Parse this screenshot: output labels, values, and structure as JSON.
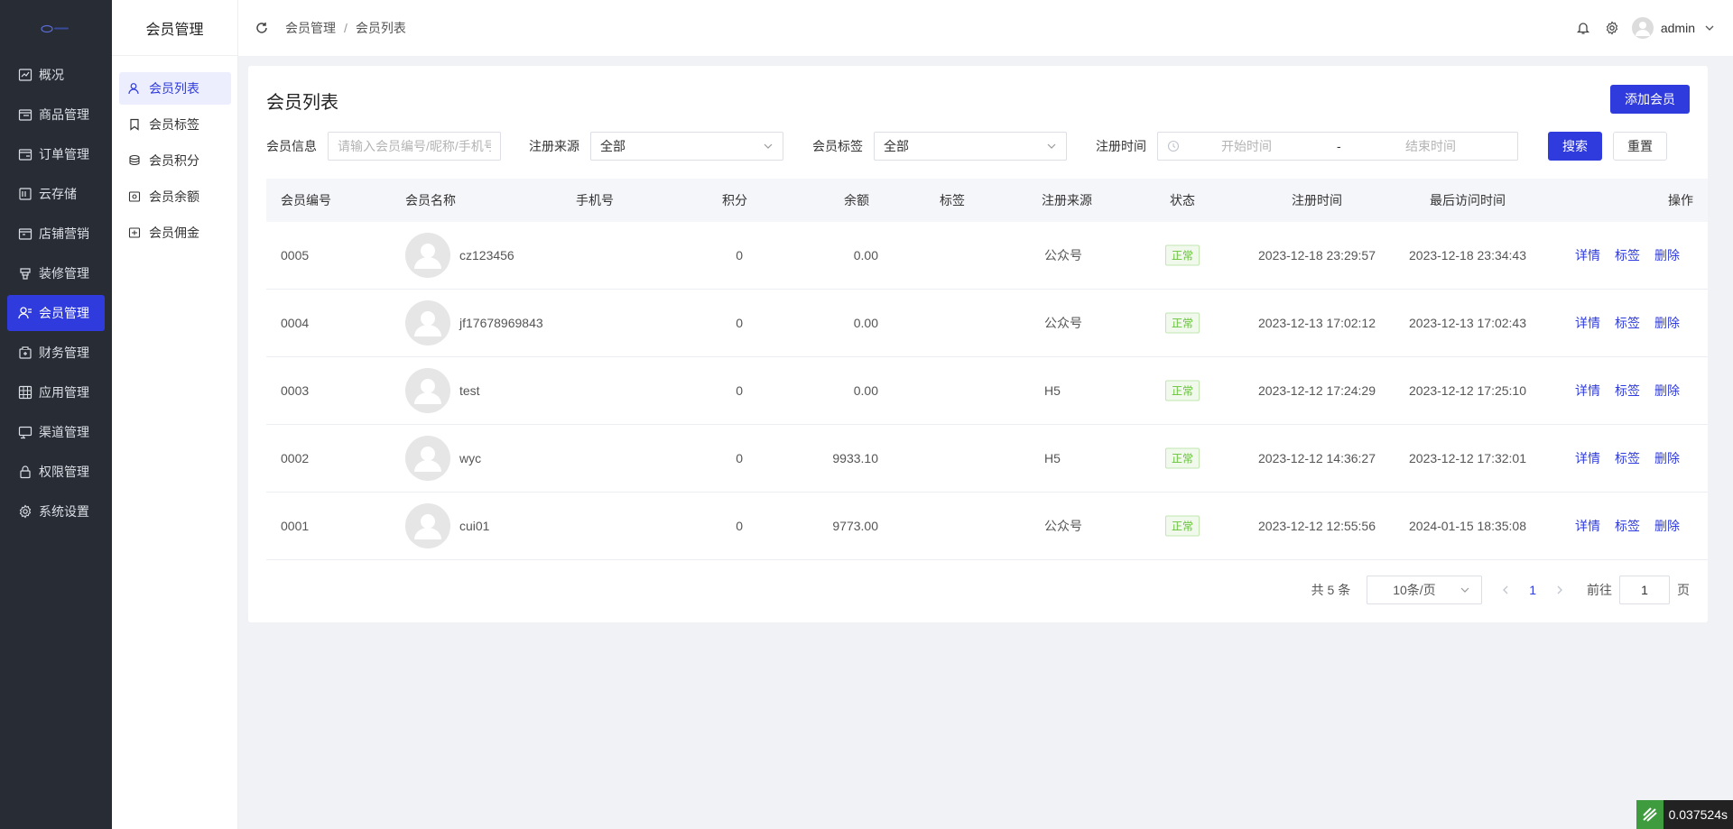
{
  "nav": {
    "items": [
      {
        "label": "概况",
        "icon": "chart-line-icon"
      },
      {
        "label": "商品管理",
        "icon": "goods-icon"
      },
      {
        "label": "订单管理",
        "icon": "order-icon"
      },
      {
        "label": "云存储",
        "icon": "cloud-storage-icon"
      },
      {
        "label": "店铺营销",
        "icon": "shop-marketing-icon"
      },
      {
        "label": "装修管理",
        "icon": "decoration-icon"
      },
      {
        "label": "会员管理",
        "icon": "member-icon"
      },
      {
        "label": "财务管理",
        "icon": "finance-icon"
      },
      {
        "label": "应用管理",
        "icon": "app-grid-icon"
      },
      {
        "label": "渠道管理",
        "icon": "channel-icon"
      },
      {
        "label": "权限管理",
        "icon": "lock-icon"
      },
      {
        "label": "系统设置",
        "icon": "gear-icon"
      }
    ],
    "active_index": 6
  },
  "submenu": {
    "title": "会员管理",
    "items": [
      {
        "label": "会员列表",
        "icon": "user-icon"
      },
      {
        "label": "会员标签",
        "icon": "bookmark-icon"
      },
      {
        "label": "会员积分",
        "icon": "coins-icon"
      },
      {
        "label": "会员余额",
        "icon": "wallet-icon"
      },
      {
        "label": "会员佣金",
        "icon": "commission-icon"
      }
    ],
    "active_index": 0
  },
  "header": {
    "breadcrumb": [
      "会员管理",
      "会员列表"
    ],
    "breadcrumb_sep": "/",
    "username": "admin"
  },
  "main": {
    "title": "会员列表",
    "add_button": "添加会员",
    "filters": {
      "info_label": "会员信息",
      "info_placeholder": "请输入会员编号/昵称/手机号",
      "source_label": "注册来源",
      "source_value": "全部",
      "tag_label": "会员标签",
      "tag_value": "全部",
      "time_label": "注册时间",
      "start_placeholder": "开始时间",
      "range_sep": "-",
      "end_placeholder": "结束时间",
      "search_button": "搜索",
      "reset_button": "重置"
    },
    "table": {
      "columns": [
        "会员编号",
        "会员名称",
        "手机号",
        "积分",
        "余额",
        "标签",
        "注册来源",
        "状态",
        "注册时间",
        "最后访问时间",
        "操作"
      ],
      "rows": [
        {
          "id": "0005",
          "name": "cz123456",
          "phone": "",
          "points": "0",
          "balance": "0.00",
          "tag": "",
          "source": "公众号",
          "status": "正常",
          "reg_time": "2023-12-18 23:29:57",
          "last_visit": "2023-12-18 23:34:43"
        },
        {
          "id": "0004",
          "name": "jf17678969843",
          "phone": "",
          "points": "0",
          "balance": "0.00",
          "tag": "",
          "source": "公众号",
          "status": "正常",
          "reg_time": "2023-12-13 17:02:12",
          "last_visit": "2023-12-13 17:02:43"
        },
        {
          "id": "0003",
          "name": "test",
          "phone": "",
          "points": "0",
          "balance": "0.00",
          "tag": "",
          "source": "H5",
          "status": "正常",
          "reg_time": "2023-12-12 17:24:29",
          "last_visit": "2023-12-12 17:25:10"
        },
        {
          "id": "0002",
          "name": "wyc",
          "phone": "",
          "points": "0",
          "balance": "9933.10",
          "tag": "",
          "source": "H5",
          "status": "正常",
          "reg_time": "2023-12-12 14:36:27",
          "last_visit": "2023-12-12 17:32:01"
        },
        {
          "id": "0001",
          "name": "cui01",
          "phone": "",
          "points": "0",
          "balance": "9773.00",
          "tag": "",
          "source": "公众号",
          "status": "正常",
          "reg_time": "2023-12-12 12:55:56",
          "last_visit": "2024-01-15 18:35:08"
        }
      ],
      "actions": {
        "detail": "详情",
        "tag": "标签",
        "delete": "删除"
      }
    },
    "pagination": {
      "total": "共 5 条",
      "page_size": "10条/页",
      "current_page": "1",
      "goto_label": "前往",
      "goto_value": "1",
      "page_suffix": "页"
    }
  },
  "timer": {
    "value": "0.037524s"
  },
  "colors": {
    "accent": "#2f3bdc",
    "nav_bg": "#282c34",
    "status_green": "#67c23a"
  }
}
